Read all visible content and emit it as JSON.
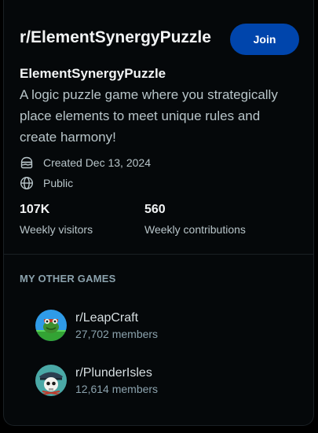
{
  "community": {
    "title": "r/ElementSynergyPuzzle",
    "join_label": "Join",
    "name": "ElementSynergyPuzzle",
    "description": "A logic puzzle game where you strategically place elements to meet unique rules and create harmony!",
    "created": "Created Dec 13, 2024",
    "visibility": "Public",
    "stats": [
      {
        "value": "107K",
        "label": "Weekly visitors"
      },
      {
        "value": "560",
        "label": "Weekly contributions"
      }
    ]
  },
  "other_games": {
    "title": "MY OTHER GAMES",
    "items": [
      {
        "name": "r/LeapCraft",
        "members": "27,702 members"
      },
      {
        "name": "r/PlunderIsles",
        "members": "12,614 members"
      }
    ]
  },
  "colors": {
    "background": "#05080a",
    "join_button": "#0045ac",
    "text_primary": "#f2f4f5",
    "text_secondary": "#b8c5c9",
    "text_muted": "#8ba2ad"
  },
  "icons": {
    "created": "cake-icon",
    "visibility": "globe-icon",
    "game_1": "frog-avatar-icon",
    "game_2": "pirate-skull-avatar-icon"
  }
}
